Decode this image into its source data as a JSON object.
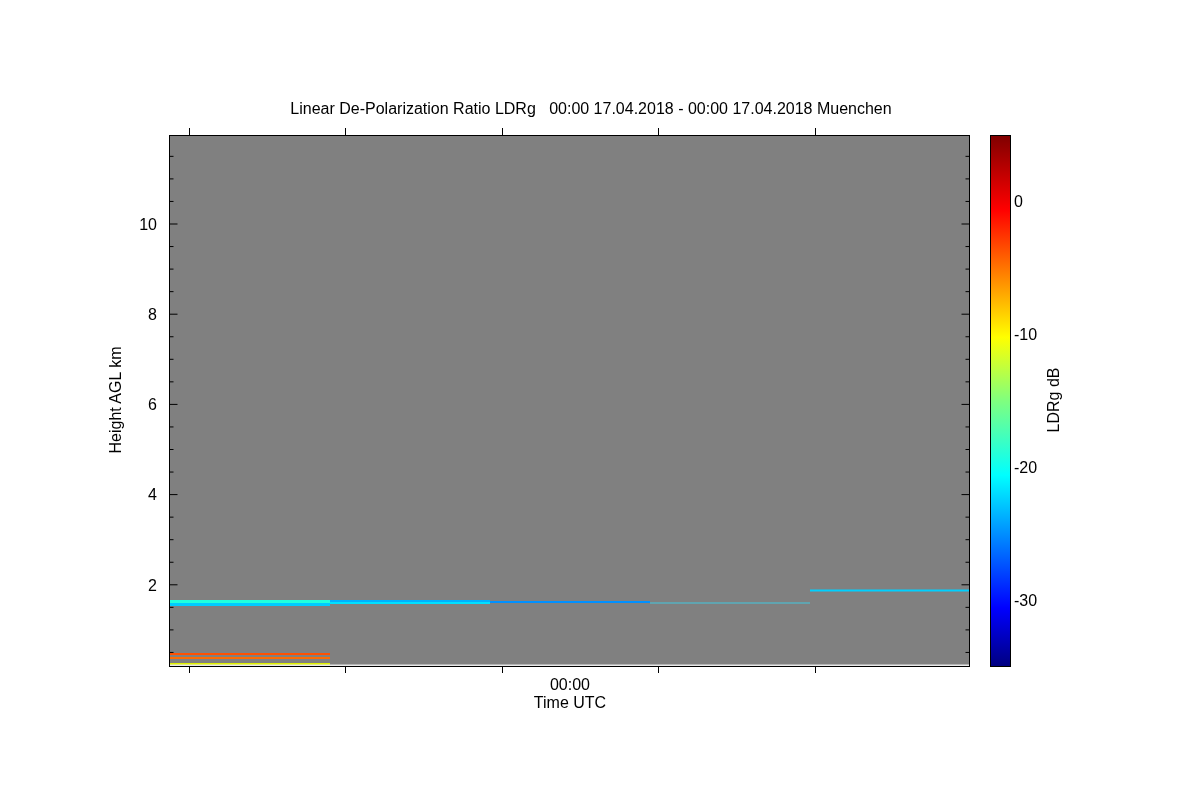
{
  "plot": {
    "title": "Linear De-Polarization Ratio LDRg   00:00 17.04.2018 - 00:00 17.04.2018 Muenchen",
    "ylabel": "Height AGL km",
    "xlabel": "Time UTC",
    "y_tick_labels": [
      "10",
      "8",
      "6",
      "4",
      "2"
    ],
    "x_tick_labels": [
      "00:00"
    ]
  },
  "colorbar": {
    "label": "LDRg dB",
    "tick_labels": [
      "0",
      "-10",
      "-20",
      "-30"
    ]
  }
}
